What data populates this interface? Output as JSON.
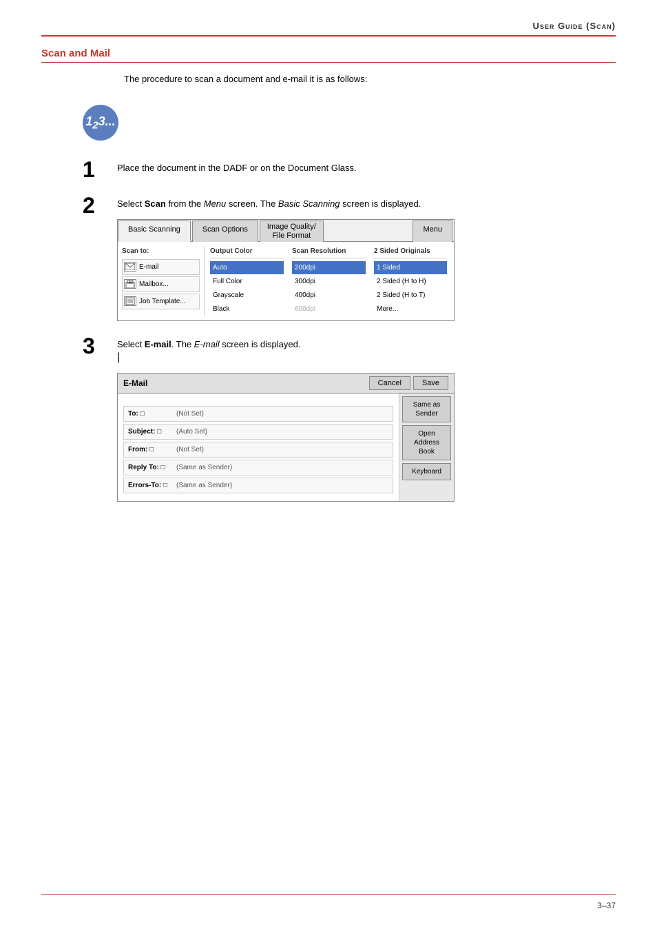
{
  "header": {
    "title": "User Guide (Scan)"
  },
  "section": {
    "title": "Scan and Mail"
  },
  "intro": {
    "text": "The procedure to scan a document and e-mail it is as follows:"
  },
  "step_icon": {
    "label": "1₂3..."
  },
  "steps": [
    {
      "number": "1",
      "text_parts": [
        {
          "type": "plain",
          "text": "Place the document in the DADF or on the Document Glass."
        }
      ]
    },
    {
      "number": "2",
      "text_parts": [
        {
          "type": "plain",
          "text": "Select "
        },
        {
          "type": "bold",
          "text": "Scan"
        },
        {
          "type": "plain",
          "text": " from the "
        },
        {
          "type": "italic",
          "text": "Menu"
        },
        {
          "type": "plain",
          "text": " screen. The "
        },
        {
          "type": "italic",
          "text": "Basic Scanning"
        },
        {
          "type": "plain",
          "text": " screen is displayed."
        }
      ]
    },
    {
      "number": "3",
      "text_parts": [
        {
          "type": "plain",
          "text": "Select "
        },
        {
          "type": "bold",
          "text": "E-mail"
        },
        {
          "type": "plain",
          "text": ". The "
        },
        {
          "type": "italic",
          "text": "E-mail"
        },
        {
          "type": "plain",
          "text": " screen is displayed."
        }
      ]
    }
  ],
  "basic_scanning_ui": {
    "tabs": [
      "Basic Scanning",
      "Scan Options",
      "Image Quality/\nFile Format",
      "Menu"
    ],
    "active_tab": "Basic Scanning",
    "scan_to_label": "Scan to:",
    "scan_items": [
      {
        "icon": "email",
        "label": "E-mail"
      },
      {
        "icon": "mailbox",
        "label": "Mailbox..."
      },
      {
        "icon": "job",
        "label": "Job Template..."
      }
    ],
    "output_color_label": "Output Color",
    "output_colors": [
      "Auto",
      "Full Color",
      "Grayscale",
      "Black"
    ],
    "scan_resolution_label": "Scan Resolution",
    "resolutions": [
      "200dpi",
      "300dpi",
      "400dpi",
      "600dpi"
    ],
    "selected_resolution": "200dpi",
    "two_sided_label": "2 Sided Originals",
    "sided_options": [
      "1 Sided",
      "2 Sided (H to H)",
      "2 Sided (H to T)",
      "More..."
    ],
    "selected_sided": "1 Sided"
  },
  "email_ui": {
    "title": "E-Mail",
    "cancel_label": "Cancel",
    "save_label": "Save",
    "fields": [
      {
        "label": "To: □",
        "value": "(Not Set)"
      },
      {
        "label": "Subject: □",
        "value": "(Auto Set)"
      },
      {
        "label": "From: □",
        "value": "(Not Set)"
      },
      {
        "label": "Reply To: □",
        "value": "(Same as Sender)"
      },
      {
        "label": "Errors-To: □",
        "value": "(Same as Sender)"
      }
    ],
    "sidebar_buttons": [
      "Same as\nSender",
      "Open\nAddress Book",
      "Keyboard"
    ]
  },
  "footer": {
    "page": "3–37"
  }
}
